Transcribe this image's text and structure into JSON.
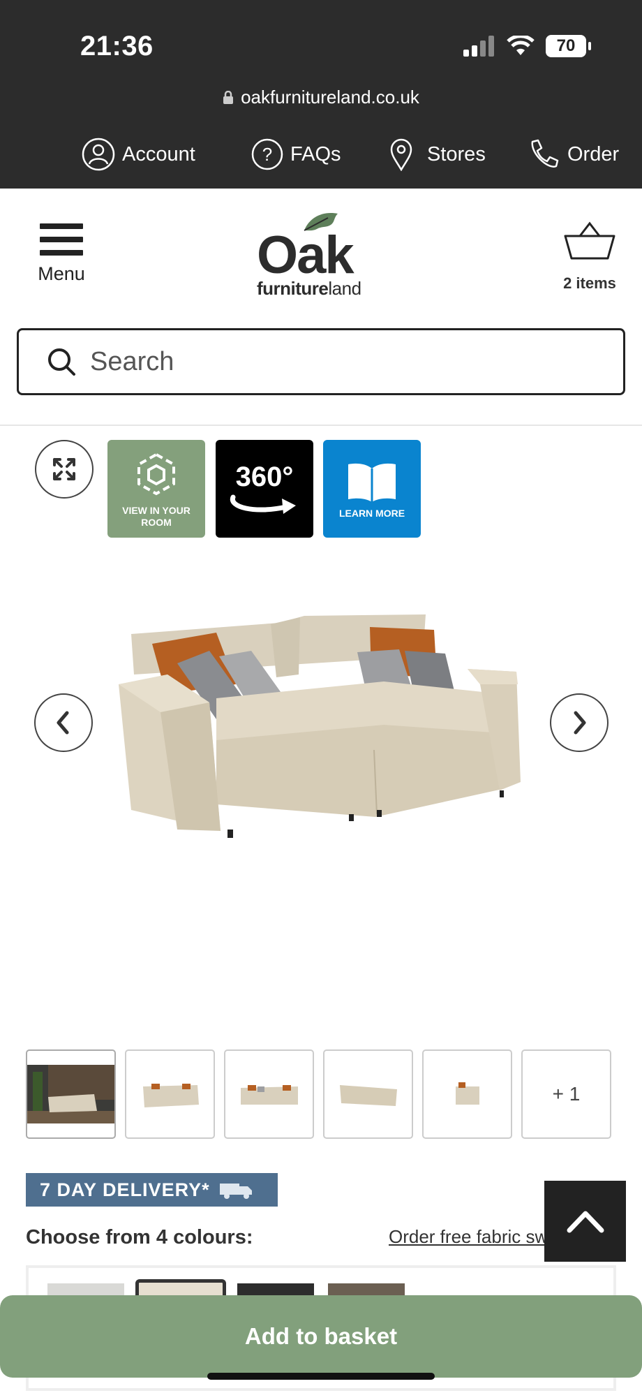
{
  "status_bar": {
    "time": "21:36",
    "battery": "70"
  },
  "browser": {
    "url": "oakfurnitureland.co.uk"
  },
  "utility_nav": {
    "account": "Account",
    "faqs": "FAQs",
    "stores": "Stores",
    "order": "Order"
  },
  "header": {
    "menu_label": "Menu",
    "logo_main": "Oak",
    "logo_sub_bold": "furniture",
    "logo_sub_light": "land",
    "basket_count": "2 items"
  },
  "search": {
    "placeholder": "Search"
  },
  "gallery": {
    "badges": {
      "view_room": "VIEW IN YOUR ROOM",
      "spin": "360°",
      "learn": "LEARN MORE"
    },
    "more_thumbs": "+ 1"
  },
  "product": {
    "delivery_badge": "7 DAY DELIVERY*",
    "colours_title": "Choose from 4 colours:",
    "swatch_link": "Order free fabric swatches",
    "add_to_basket": "Add to basket"
  },
  "colors": {
    "topbar": "#2c2c2c",
    "accent_green": "#82a07c",
    "delivery_blue": "#4f6f8f",
    "learn_blue": "#0a84cf"
  }
}
